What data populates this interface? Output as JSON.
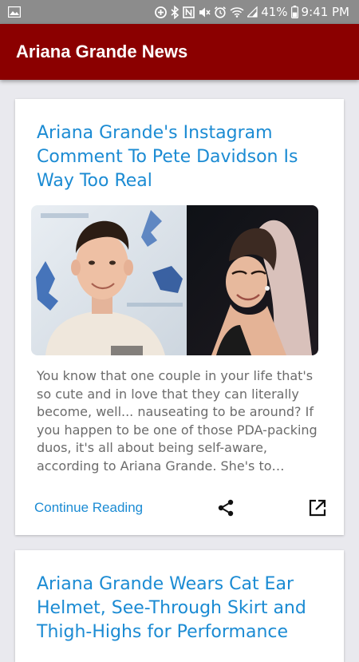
{
  "status_bar": {
    "battery_percent": "41%",
    "time": "9:41 PM",
    "icons": [
      "image-icon",
      "data-saver-icon",
      "bluetooth-icon",
      "nfc-icon",
      "mute-icon",
      "alarm-icon",
      "wifi-icon",
      "cell-signal-icon",
      "battery-icon"
    ]
  },
  "app_bar": {
    "title": "Ariana Grande News",
    "color": "#8b0000"
  },
  "articles": [
    {
      "title": "Ariana Grande's Instagram Comment To Pete Davidson Is Way Too Real",
      "image_alt": "Pete Davidson and Ariana Grande photo",
      "excerpt": "You know that one couple in your life that's so cute and in love that they can literally become, well... nauseating to be around? If you happen to be one of those PDA-packing duos, it's all about being self-aware, according to Ariana Grande. She's to…",
      "continue_label": "Continue Reading",
      "share_icon": "share-icon",
      "open_icon": "open-in-new-icon"
    },
    {
      "title": "Ariana Grande Wears Cat Ear Helmet, See-Through Skirt and Thigh-Highs for Performance"
    }
  ],
  "colors": {
    "accent": "#1b8bd3",
    "background": "#e9e9ee",
    "excerpt_text": "#6b6b6b"
  }
}
